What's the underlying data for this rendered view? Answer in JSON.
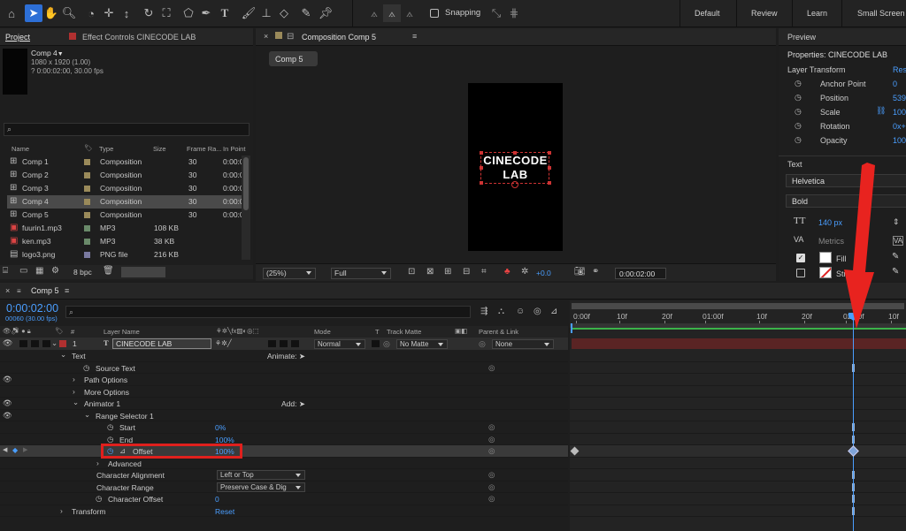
{
  "toolbar": {
    "snapping_label": "Snapping",
    "workspaces": [
      "Default",
      "Review",
      "Learn",
      "Small Screen"
    ]
  },
  "project": {
    "tab_label": "Project",
    "effect_controls_label": "Effect Controls CINECODE LAB",
    "comp_name": "Comp 4",
    "comp_res": "1080 x 1920 (1.00)",
    "comp_dur": "? 0:00:02:00, 30.00 fps",
    "search_placeholder": "",
    "columns": [
      "Name",
      "Type",
      "Size",
      "Frame Ra...",
      "In Point"
    ],
    "items": [
      {
        "name": "Comp 1",
        "type": "Composition",
        "size": "",
        "fps": "30",
        "in": "0:00:0",
        "icon": "comp-icon",
        "color": "#9a8a5a"
      },
      {
        "name": "Comp 2",
        "type": "Composition",
        "size": "",
        "fps": "30",
        "in": "0:00:0",
        "icon": "comp-icon",
        "color": "#9a8a5a"
      },
      {
        "name": "Comp 3",
        "type": "Composition",
        "size": "",
        "fps": "30",
        "in": "0:00:0",
        "icon": "comp-icon",
        "color": "#9a8a5a"
      },
      {
        "name": "Comp 4",
        "type": "Composition",
        "size": "",
        "fps": "30",
        "in": "0:00:0",
        "icon": "comp-icon",
        "color": "#9a8a5a"
      },
      {
        "name": "Comp 5",
        "type": "Composition",
        "size": "",
        "fps": "30",
        "in": "0:00:0",
        "icon": "comp-icon",
        "color": "#9a8a5a"
      },
      {
        "name": "fuurin1.mp3",
        "type": "MP3",
        "size": "108 KB",
        "fps": "",
        "in": "",
        "icon": "audio-file-icon",
        "color": "#6a8a6a"
      },
      {
        "name": "ken.mp3",
        "type": "MP3",
        "size": "38 KB",
        "fps": "",
        "in": "",
        "icon": "audio-file-icon",
        "color": "#6a8a6a"
      },
      {
        "name": "logo3.png",
        "type": "PNG file",
        "size": "216 KB",
        "fps": "",
        "in": "",
        "icon": "image-file-icon",
        "color": "#7a7aa0"
      }
    ],
    "selected_index": 3,
    "bpc_label": "8 bpc"
  },
  "composition": {
    "tab_label": "Composition Comp 5",
    "breadcrumb": "Comp 5",
    "overlay_line1": "CINECODE",
    "overlay_line2": "LAB",
    "zoom": "(25%)",
    "resolution": "Full",
    "exposure": "+0.0",
    "timecode": "0:00:02:00"
  },
  "properties": {
    "preview_tab": "Preview",
    "title": "Properties: CINECODE LAB",
    "layer_transform_label": "Layer Transform",
    "reset_label": "Res",
    "transform_items": [
      {
        "label": "Anchor Point",
        "value": "0"
      },
      {
        "label": "Position",
        "value": "539"
      },
      {
        "label": "Scale",
        "value": "100"
      },
      {
        "label": "Rotation",
        "value": "0x+"
      },
      {
        "label": "Opacity",
        "value": "100"
      }
    ],
    "text_label": "Text",
    "font": "Helvetica",
    "style": "Bold",
    "font_size": "140 px",
    "kerning": "Metrics",
    "fill_label": "Fill",
    "stroke_label": "Str"
  },
  "timeline": {
    "tab_label": "Comp 5",
    "timecode": "0:00:02:00",
    "timecode_sub": "00060 (30.00 fps)",
    "col_headers": {
      "num": "#",
      "layer_name": "Layer Name",
      "mode": "Mode",
      "t": "T",
      "track_matte": "Track Matte",
      "parent": "Parent & Link"
    },
    "layer": {
      "num": "1",
      "name": "CINECODE LAB",
      "mode": "Normal",
      "matte": "No Matte",
      "parent": "None"
    },
    "animate_label": "Animate:",
    "add_label": "Add:",
    "rows": [
      {
        "label": "Text",
        "value": ""
      },
      {
        "label": "Source Text",
        "value": ""
      },
      {
        "label": "Path Options",
        "value": ""
      },
      {
        "label": "More Options",
        "value": ""
      },
      {
        "label": "Animator 1",
        "value": ""
      },
      {
        "label": "Range Selector 1",
        "value": ""
      },
      {
        "label": "Start",
        "value": "0%"
      },
      {
        "label": "End",
        "value": "100%"
      },
      {
        "label": "Offset",
        "value": "100%"
      },
      {
        "label": "Advanced",
        "value": ""
      },
      {
        "label": "Character Alignment",
        "value": "Left or Top"
      },
      {
        "label": "Character Range",
        "value": "Preserve Case & Dig"
      },
      {
        "label": "Character Offset",
        "value": "0"
      },
      {
        "label": "Transform",
        "value": "Reset"
      }
    ],
    "ruler_ticks": [
      "0:00f",
      "10f",
      "20f",
      "01:00f",
      "10f",
      "20f",
      "02:00f",
      "10f"
    ]
  },
  "colors": {
    "accent": "#2d8ceb",
    "highlight": "#e0201d",
    "arrow": "#e8231f",
    "layer_bar": "#5a2424"
  }
}
